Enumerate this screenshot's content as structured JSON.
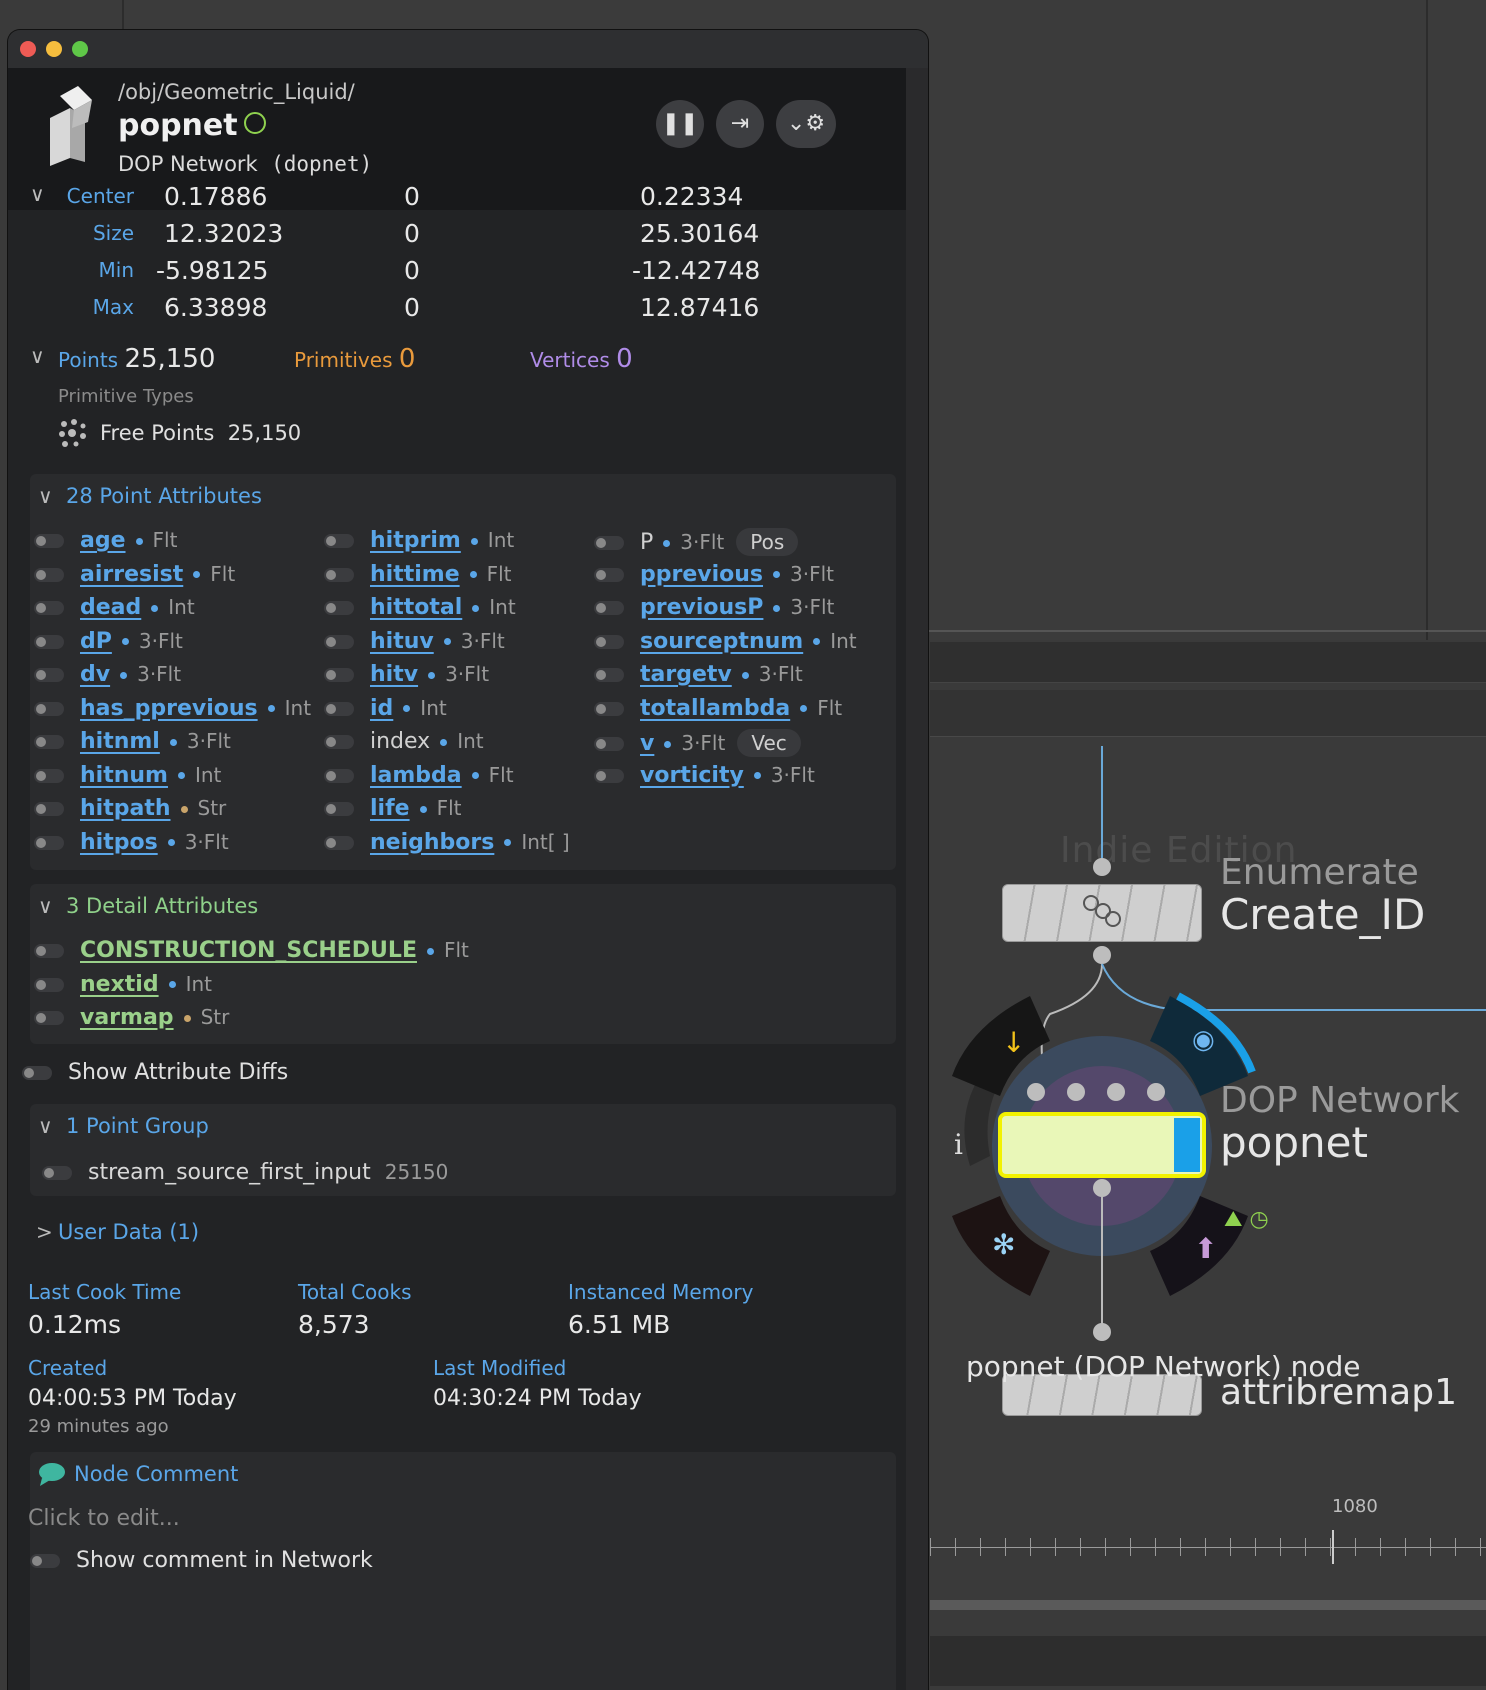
{
  "window": {
    "path": "/obj/Geometric_Liquid/",
    "node_name": "popnet",
    "node_type_label": "DOP Network",
    "node_type_internal": "(dopnet)"
  },
  "header_buttons": {
    "pause": "❚❚",
    "pin": "⇥",
    "settings": "⌄⚙"
  },
  "bbox": {
    "rows": [
      {
        "key": "Center",
        "x": "0.17886",
        "y": "0",
        "z": "0.22334"
      },
      {
        "key": "Size",
        "x": "12.32023",
        "y": "0",
        "z": "25.30164"
      },
      {
        "key": "Min",
        "x": "-5.98125",
        "y": "0",
        "z": "-12.42748"
      },
      {
        "key": "Max",
        "x": "6.33898",
        "y": "0",
        "z": "12.87416"
      }
    ]
  },
  "counts": {
    "points_label": "Points",
    "points_value": "25,150",
    "primitives_label": "Primitives",
    "primitives_value": "0",
    "vertices_label": "Vertices",
    "vertices_value": "0",
    "prim_types_label": "Primitive Types",
    "free_points_label": "Free Points",
    "free_points_value": "25,150"
  },
  "point_attrs": {
    "title": "28 Point Attributes",
    "col1": [
      {
        "name": "age",
        "type": "Flt"
      },
      {
        "name": "airresist",
        "type": "Flt"
      },
      {
        "name": "dead",
        "type": "Int"
      },
      {
        "name": "dP",
        "type": "3·Flt"
      },
      {
        "name": "dv",
        "type": "3·Flt"
      },
      {
        "name": "has_pprevious",
        "type": "Int"
      },
      {
        "name": "hitnml",
        "type": "3·Flt"
      },
      {
        "name": "hitnum",
        "type": "Int"
      },
      {
        "name": "hitpath",
        "type": "Str"
      },
      {
        "name": "hitpos",
        "type": "3·Flt"
      }
    ],
    "col2": [
      {
        "name": "hitprim",
        "type": "Int"
      },
      {
        "name": "hittime",
        "type": "Flt"
      },
      {
        "name": "hittotal",
        "type": "Int"
      },
      {
        "name": "hituv",
        "type": "3·Flt"
      },
      {
        "name": "hitv",
        "type": "3·Flt"
      },
      {
        "name": "id",
        "type": "Int"
      },
      {
        "name": "index",
        "type": "Int"
      },
      {
        "name": "lambda",
        "type": "Flt"
      },
      {
        "name": "life",
        "type": "Flt"
      },
      {
        "name": "neighbors",
        "type": "Int[ ]"
      }
    ],
    "col3": [
      {
        "name": "P",
        "type": "3·Flt",
        "tag": "Pos"
      },
      {
        "name": "pprevious",
        "type": "3·Flt"
      },
      {
        "name": "previousP",
        "type": "3·Flt"
      },
      {
        "name": "sourceptnum",
        "type": "Int"
      },
      {
        "name": "targetv",
        "type": "3·Flt"
      },
      {
        "name": "totallambda",
        "type": "Flt"
      },
      {
        "name": "v",
        "type": "3·Flt",
        "tag": "Vec"
      },
      {
        "name": "vorticity",
        "type": "3·Flt"
      }
    ]
  },
  "detail_attrs": {
    "title": "3 Detail Attributes",
    "items": [
      {
        "name": "CONSTRUCTION_SCHEDULE",
        "type": "Flt"
      },
      {
        "name": "nextid",
        "type": "Int"
      },
      {
        "name": "varmap",
        "type": "Str"
      }
    ]
  },
  "show_diffs_label": "Show Attribute Diffs",
  "point_group": {
    "title": "1 Point Group",
    "name": "stream_source_first_input",
    "count": "25150"
  },
  "user_data_label": "User Data (1)",
  "stats": {
    "last_cook_label": "Last Cook Time",
    "last_cook_value": "0.12ms",
    "total_cooks_label": "Total Cooks",
    "total_cooks_value": "8,573",
    "inst_mem_label": "Instanced Memory",
    "inst_mem_value": "6.51 MB",
    "created_label": "Created",
    "created_value": "04:00:53 PM Today",
    "created_ago": "29 minutes ago",
    "modified_label": "Last Modified",
    "modified_value": "04:30:24 PM Today"
  },
  "comment": {
    "title": "Node Comment",
    "placeholder": "Click to edit...",
    "show_in_network": "Show comment in Network"
  },
  "network": {
    "watermark": "Indie Edition",
    "enum_type": "Enumerate",
    "enum_name": "Create_ID",
    "dop_type": "DOP Network",
    "dop_name": "popnet",
    "bottom_label": "popnet (DOP Network) node",
    "bottom_node_name": "attribremap1",
    "frame": "1080"
  },
  "colors": {
    "accent_blue": "#5aa6e8",
    "primitives_orange": "#e99a3c",
    "vertices_purple": "#b08ce8",
    "detail_green": "#8fd18a",
    "node_selected_yellow": "#f2f200"
  }
}
